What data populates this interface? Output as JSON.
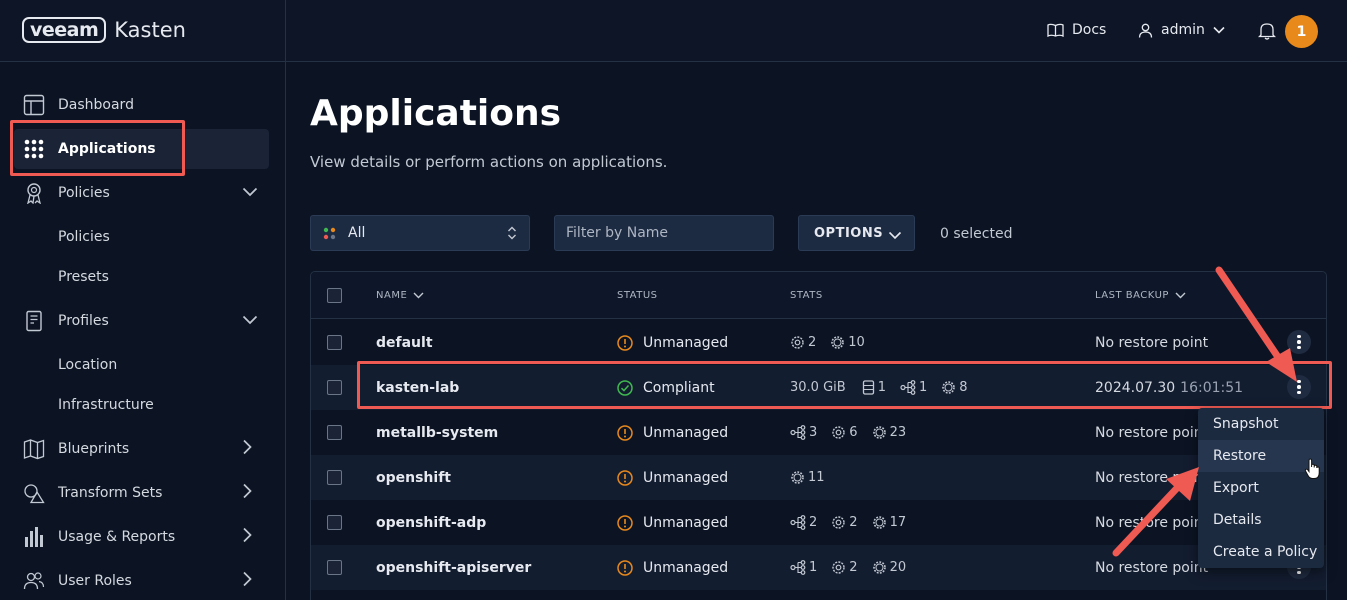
{
  "app": {
    "logo_brand": "veeam",
    "logo_product": "Kasten"
  },
  "topnav": {
    "docs_label": "Docs",
    "user_label": "admin",
    "notification_count": "1"
  },
  "sidebar": {
    "items": [
      {
        "label": "Dashboard",
        "icon": "dashboard-icon"
      },
      {
        "label": "Applications",
        "icon": "grid-dots-icon",
        "active": true
      },
      {
        "label": "Policies",
        "icon": "award-icon",
        "expandable": true
      },
      {
        "label": "Policies",
        "sub": true
      },
      {
        "label": "Presets",
        "sub": true
      },
      {
        "label": "Profiles",
        "icon": "document-icon",
        "expandable": true
      },
      {
        "label": "Location",
        "sub": true
      },
      {
        "label": "Infrastructure",
        "sub": true
      },
      {
        "label": "Blueprints",
        "icon": "map-icon"
      },
      {
        "label": "Transform Sets",
        "icon": "shapes-icon"
      },
      {
        "label": "Usage & Reports",
        "icon": "bar-chart-icon"
      },
      {
        "label": "User Roles",
        "icon": "users-icon"
      }
    ]
  },
  "page": {
    "title": "Applications",
    "subtitle": "View details or perform actions on applications."
  },
  "toolbar": {
    "filter_select_value": "All",
    "filter_placeholder": "Filter by Name",
    "options_label": "OPTIONS",
    "selected_count": "0 selected"
  },
  "table": {
    "columns": {
      "name": "NAME",
      "status": "STATUS",
      "stats": "STATS",
      "last_backup": "LAST BACKUP"
    },
    "rows": [
      {
        "name": "default",
        "status": "Unmanaged",
        "stats": [
          {
            "icon": "gear-cog-icon",
            "value": "2"
          },
          {
            "icon": "gear-icon",
            "value": "10"
          }
        ],
        "last_backup": "No restore point",
        "last_backup_time": ""
      },
      {
        "name": "kasten-lab",
        "status": "Compliant",
        "size": "30.0 GiB",
        "stats": [
          {
            "icon": "database-icon",
            "value": "1"
          },
          {
            "icon": "network-icon",
            "value": "1"
          },
          {
            "icon": "gear-icon",
            "value": "8"
          }
        ],
        "last_backup": "2024.07.30",
        "last_backup_time": "16:01:51"
      },
      {
        "name": "metallb-system",
        "status": "Unmanaged",
        "stats": [
          {
            "icon": "network-icon",
            "value": "3"
          },
          {
            "icon": "gear-cog-icon",
            "value": "6"
          },
          {
            "icon": "gear-icon",
            "value": "23"
          }
        ],
        "last_backup": "No restore point",
        "last_backup_time": ""
      },
      {
        "name": "openshift",
        "status": "Unmanaged",
        "stats": [
          {
            "icon": "gear-icon",
            "value": "11"
          }
        ],
        "last_backup": "No restore point",
        "last_backup_time": ""
      },
      {
        "name": "openshift-adp",
        "status": "Unmanaged",
        "stats": [
          {
            "icon": "network-icon",
            "value": "2"
          },
          {
            "icon": "gear-cog-icon",
            "value": "2"
          },
          {
            "icon": "gear-icon",
            "value": "17"
          }
        ],
        "last_backup": "No restore point",
        "last_backup_time": ""
      },
      {
        "name": "openshift-apiserver",
        "status": "Unmanaged",
        "stats": [
          {
            "icon": "network-icon",
            "value": "1"
          },
          {
            "icon": "gear-cog-icon",
            "value": "2"
          },
          {
            "icon": "gear-icon",
            "value": "20"
          }
        ],
        "last_backup": "No restore point",
        "last_backup_time": ""
      }
    ]
  },
  "context_menu": {
    "items": [
      "Snapshot",
      "Restore",
      "Export",
      "Details",
      "Create a Policy"
    ],
    "hovered": "Restore"
  },
  "colors": {
    "background": "#0c1424",
    "highlight": "#ef5a52",
    "warning": "#e8891c",
    "success": "#3fb950",
    "notification": "#e8891c"
  }
}
